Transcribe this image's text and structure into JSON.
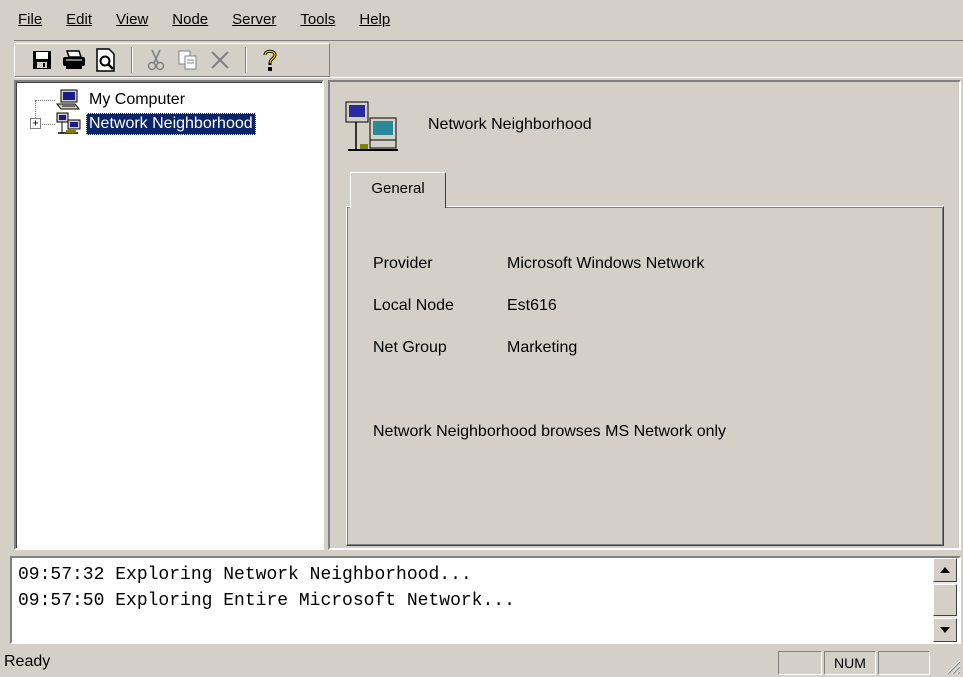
{
  "menu": [
    {
      "label": "File",
      "icon": ""
    },
    {
      "label": "Edit"
    },
    {
      "label": "View"
    },
    {
      "label": "Node"
    },
    {
      "label": "Server"
    },
    {
      "label": "Tools"
    },
    {
      "label": "Help"
    }
  ],
  "toolbar": {
    "icons": [
      "save-icon",
      "print-icon",
      "print-preview-icon",
      "cut-icon",
      "copy-icon",
      "delete-icon",
      "help-icon"
    ]
  },
  "tree": {
    "items": [
      {
        "label": "My Computer",
        "icon": "computer-icon",
        "selected": false
      },
      {
        "label": "Network Neighborhood",
        "icon": "network-icon",
        "selected": true,
        "expander": "+"
      }
    ]
  },
  "detail": {
    "title": "Network Neighborhood",
    "icon": "network-icon",
    "tab_label": "General",
    "properties": [
      {
        "label": "Provider",
        "value": "Microsoft Windows Network"
      },
      {
        "label": "Local Node",
        "value": "Est616"
      },
      {
        "label": "Net Group",
        "value": "Marketing"
      }
    ],
    "note": "Network Neighborhood browses MS Network only"
  },
  "log": {
    "lines": [
      "09:57:32 Exploring Network Neighborhood...",
      "09:57:50 Exploring Entire Microsoft Network..."
    ]
  },
  "status": {
    "text": "Ready",
    "num": "NUM"
  },
  "colors": {
    "face": "#d4d0c8",
    "selection": "#0a246a",
    "shadow": "#808080",
    "highlight": "#ffffff"
  }
}
